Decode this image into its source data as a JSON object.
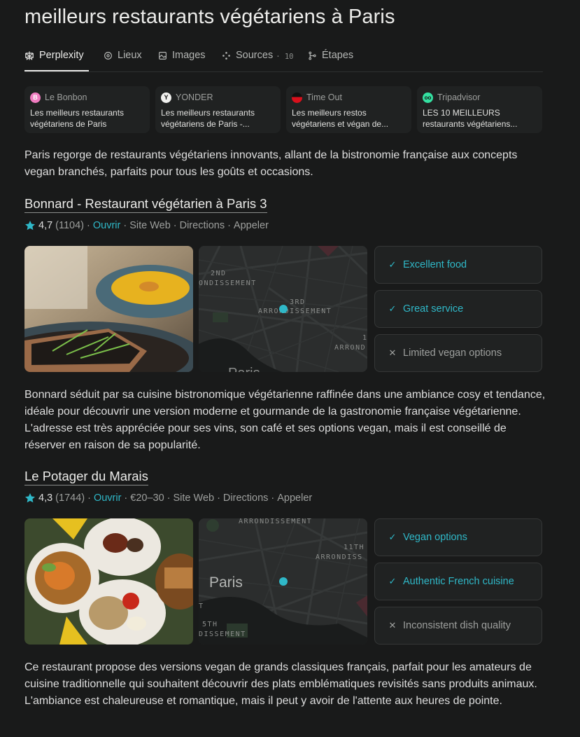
{
  "page": {
    "title": "meilleurs restaurants végétariens à Paris"
  },
  "tabs": [
    {
      "label": "Perplexity",
      "icon": "perplexity-logo-icon",
      "active": true
    },
    {
      "label": "Lieux",
      "icon": "location-pin-icon"
    },
    {
      "label": "Images",
      "icon": "image-icon"
    },
    {
      "label": "Sources",
      "icon": "sources-icon",
      "count": "10"
    },
    {
      "label": "Étapes",
      "icon": "steps-icon"
    }
  ],
  "sources": [
    {
      "site": "Le Bonbon",
      "title": "Les meilleurs restaurants végétariens de Paris",
      "favicon_color": "#f07cc0",
      "favicon_text": "B"
    },
    {
      "site": "YONDER",
      "title": "Les meilleurs restaurants végétariens de Paris -...",
      "favicon_color": "#1a1a1a",
      "favicon_text": "Y"
    },
    {
      "site": "Time Out",
      "title": "Les meilleurs restos végétariens et végan de...",
      "favicon_color": "#d8101c",
      "favicon_text": ""
    },
    {
      "site": "Tripadvisor",
      "title": "LES 10 MEILLEURS restaurants végétariens...",
      "favicon_color": "#34e0a1",
      "favicon_text": "oo"
    }
  ],
  "intro": "Paris regorge de restaurants végétariens innovants, allant de la bistronomie française aux concepts vegan branchés, parfaits pour tous les goûts et occasions.",
  "restaurants": [
    {
      "name": "Bonnard - Restaurant végétarien à Paris 3",
      "rating": "4,7",
      "reviews": "(1104)",
      "status": "Ouvrir",
      "price": "",
      "links": [
        "Site Web",
        "Directions",
        "Appeler"
      ],
      "map_labels": [
        "2ND",
        "ONDISSEMENT",
        "3RD",
        "ARRONDISSEMENT",
        "1",
        "ARROND",
        "Paris"
      ],
      "highlights": [
        {
          "text": "Excellent food",
          "positive": true
        },
        {
          "text": "Great service",
          "positive": true
        },
        {
          "text": "Limited vegan options",
          "positive": false
        }
      ],
      "description": "Bonnard séduit par sa cuisine bistronomique végétarienne raffinée dans une ambiance cosy et tendance, idéale pour découvrir une version moderne et gourmande de la gastronomie française végétarienne. L'adresse est très appréciée pour ses vins, son café et ses options vegan, mais il est conseillé de réserver en raison de sa popularité."
    },
    {
      "name": "Le Potager du Marais",
      "rating": "4,3",
      "reviews": "(1744)",
      "status": "Ouvrir",
      "price": "€20–30",
      "links": [
        "Site Web",
        "Directions",
        "Appeler"
      ],
      "map_labels": [
        "ARRONDISSEMENT",
        "11TH",
        "ARRONDISS",
        "Paris",
        "T",
        "5TH",
        "DISSEMENT"
      ],
      "highlights": [
        {
          "text": "Vegan options",
          "positive": true
        },
        {
          "text": "Authentic French cuisine",
          "positive": true
        },
        {
          "text": "Inconsistent dish quality",
          "positive": false
        }
      ],
      "description": "Ce restaurant propose des versions vegan de grands classiques français, parfait pour les amateurs de cuisine traditionnelle qui souhaitent découvrir des plats emblématiques revisités sans produits animaux. L'ambiance est chaleureuse et romantique, mais il peut y avoir de l'attente aux heures de pointe."
    }
  ],
  "colors": {
    "accent": "#2fb8c8",
    "background": "#191a1a",
    "card": "#202222"
  },
  "icons": {
    "check": "✓",
    "cross": "✕",
    "star": "star-icon"
  }
}
